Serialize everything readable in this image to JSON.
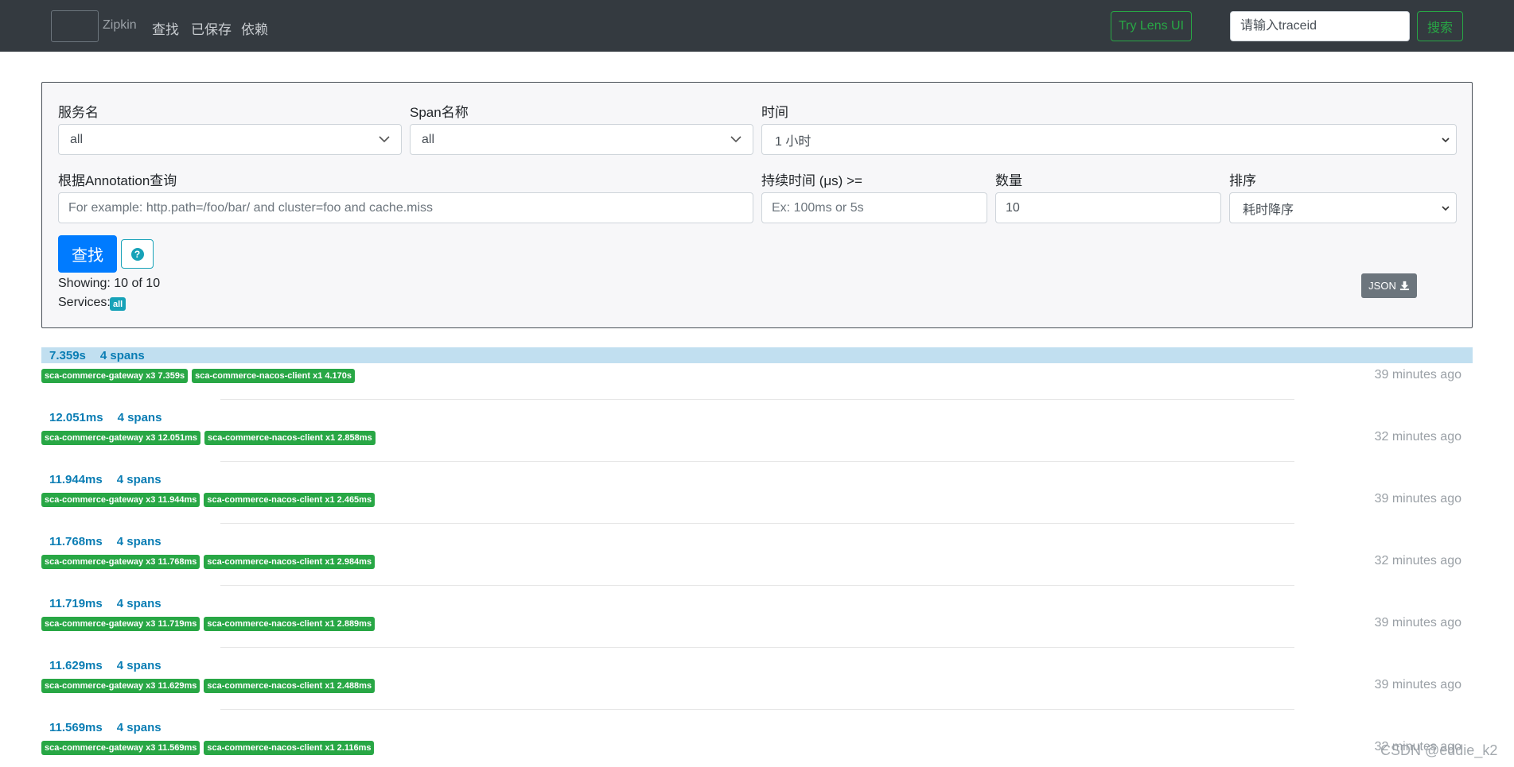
{
  "navbar": {
    "brand": "Zipkin",
    "links": [
      "查找",
      "已保存",
      "依赖"
    ],
    "lens_button": "Try Lens UI",
    "traceid_placeholder": "请输入traceid",
    "search_button": "搜索"
  },
  "form": {
    "service": {
      "label": "服务名",
      "value": "all"
    },
    "span": {
      "label": "Span名称",
      "value": "all"
    },
    "time": {
      "label": "时间",
      "value": "1 小时"
    },
    "annotation": {
      "label": "根据Annotation查询",
      "placeholder": "For example: http.path=/foo/bar/ and cluster=foo and cache.miss"
    },
    "duration": {
      "label": "持续时间 (μs) >=",
      "placeholder": "Ex: 100ms or 5s"
    },
    "limit": {
      "label": "数量",
      "value": "10"
    },
    "sort": {
      "label": "排序",
      "value": "耗时降序"
    },
    "find_button": "查找",
    "help_icon": "question-circle-icon",
    "showing": "Showing: 10 of 10",
    "services_label": "Services:",
    "services_badge": "all",
    "json_button": "JSON"
  },
  "traces": [
    {
      "duration": "7.359s",
      "spans": "4 spans",
      "tags": [
        "sca-commerce-gateway x3 7.359s",
        "sca-commerce-nacos-client x1 4.170s"
      ],
      "ago": "39 minutes ago",
      "highlight": true
    },
    {
      "duration": "12.051ms",
      "spans": "4 spans",
      "tags": [
        "sca-commerce-gateway x3 12.051ms",
        "sca-commerce-nacos-client x1 2.858ms"
      ],
      "ago": "32 minutes ago"
    },
    {
      "duration": "11.944ms",
      "spans": "4 spans",
      "tags": [
        "sca-commerce-gateway x3 11.944ms",
        "sca-commerce-nacos-client x1 2.465ms"
      ],
      "ago": "39 minutes ago"
    },
    {
      "duration": "11.768ms",
      "spans": "4 spans",
      "tags": [
        "sca-commerce-gateway x3 11.768ms",
        "sca-commerce-nacos-client x1 2.984ms"
      ],
      "ago": "32 minutes ago"
    },
    {
      "duration": "11.719ms",
      "spans": "4 spans",
      "tags": [
        "sca-commerce-gateway x3 11.719ms",
        "sca-commerce-nacos-client x1 2.889ms"
      ],
      "ago": "39 minutes ago"
    },
    {
      "duration": "11.629ms",
      "spans": "4 spans",
      "tags": [
        "sca-commerce-gateway x3 11.629ms",
        "sca-commerce-nacos-client x1 2.488ms"
      ],
      "ago": "39 minutes ago"
    },
    {
      "duration": "11.569ms",
      "spans": "4 spans",
      "tags": [
        "sca-commerce-gateway x3 11.569ms",
        "sca-commerce-nacos-client x1 2.116ms"
      ],
      "ago": "32 minutes ago"
    }
  ],
  "watermark": "CSDN @eddie_k2"
}
